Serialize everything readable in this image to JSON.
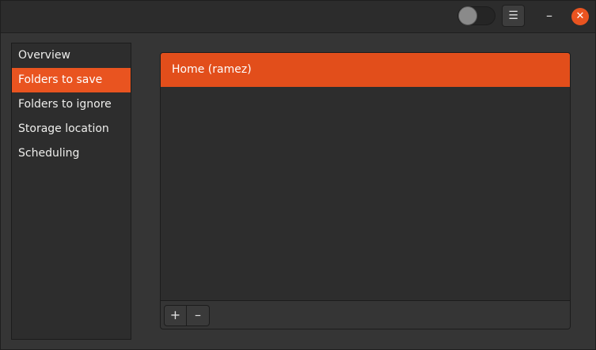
{
  "header": {
    "menu_glyph": "☰",
    "minimize_glyph": "–",
    "close_glyph": "✕",
    "toggle_icon": "toggle-switch-icon",
    "accent_color": "#e95420"
  },
  "sidebar": {
    "items": [
      {
        "label": "Overview",
        "selected": false
      },
      {
        "label": "Folders to save",
        "selected": true
      },
      {
        "label": "Folders to ignore",
        "selected": false
      },
      {
        "label": "Storage location",
        "selected": false
      },
      {
        "label": "Scheduling",
        "selected": false
      }
    ]
  },
  "main": {
    "folders": [
      {
        "label": "Home (ramez)",
        "selected": true
      }
    ],
    "toolbar": {
      "add_label": "+",
      "remove_label": "–"
    }
  }
}
